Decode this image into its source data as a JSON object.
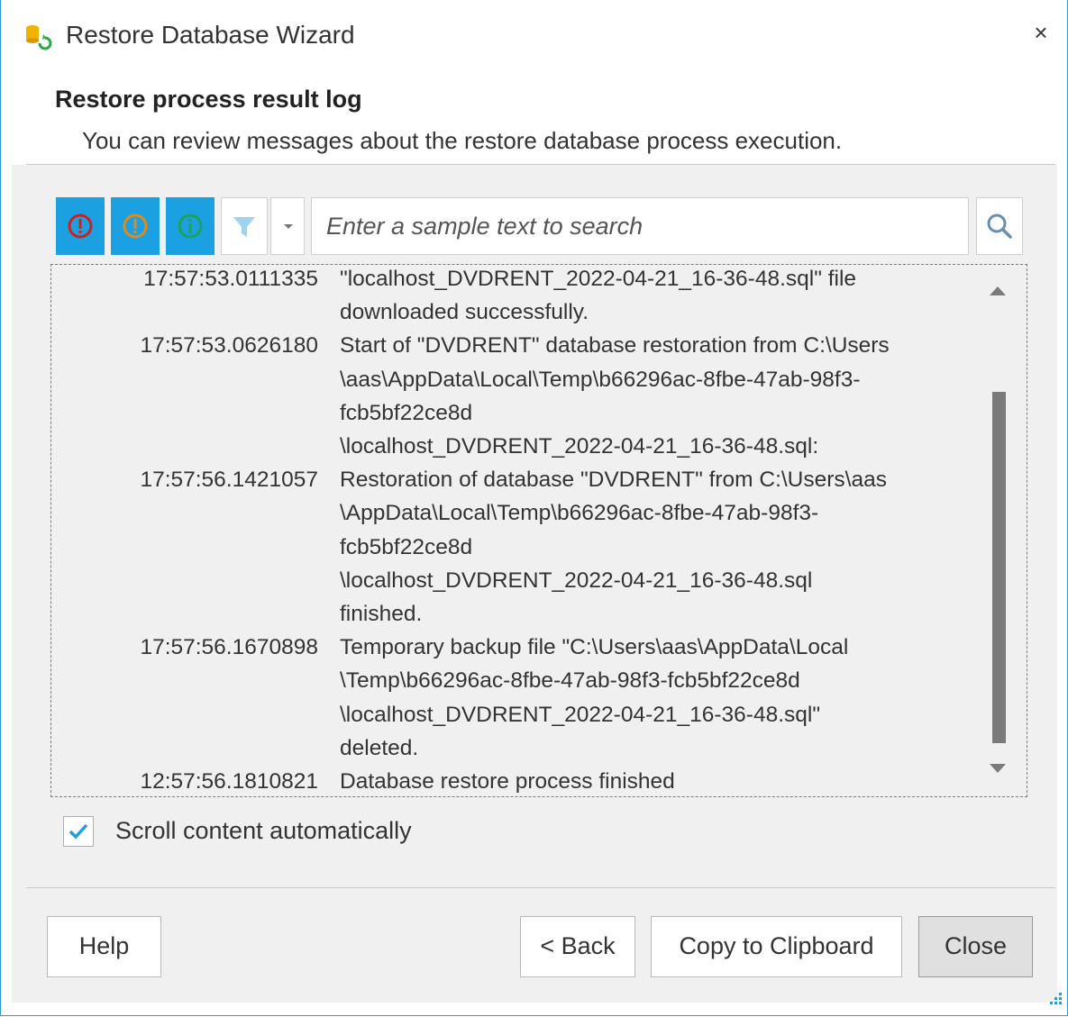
{
  "window": {
    "title": "Restore Database Wizard",
    "close_glyph": "×"
  },
  "header": {
    "title": "Restore process result log",
    "subtitle": "You can review messages about the restore database process execution."
  },
  "toolbar": {
    "errors_icon": "error-circle-icon",
    "warnings_icon": "warning-circle-icon",
    "info_icon": "info-circle-icon",
    "filter_icon": "funnel-icon",
    "accent_color": "#1ba1e2",
    "search_placeholder": "Enter a sample text to search"
  },
  "log": [
    {
      "time": "17:57:53.0111335",
      "lines": [
        "\"localhost_DVDRENT_2022-04-21_16-36-48.sql\" file",
        "downloaded successfully."
      ]
    },
    {
      "time": "17:57:53.0626180",
      "lines": [
        "Start of \"DVDRENT\" database restoration from C:\\Users",
        "\\aas\\AppData\\Local\\Temp\\b66296ac-8fbe-47ab-98f3-",
        "fcb5bf22ce8d",
        "\\localhost_DVDRENT_2022-04-21_16-36-48.sql:"
      ]
    },
    {
      "time": "17:57:56.1421057",
      "lines": [
        "Restoration of database \"DVDRENT\" from C:\\Users\\aas",
        "\\AppData\\Local\\Temp\\b66296ac-8fbe-47ab-98f3-",
        "fcb5bf22ce8d",
        "\\localhost_DVDRENT_2022-04-21_16-36-48.sql",
        "finished."
      ]
    },
    {
      "time": "17:57:56.1670898",
      "lines": [
        "Temporary backup file \"C:\\Users\\aas\\AppData\\Local",
        "\\Temp\\b66296ac-8fbe-47ab-98f3-fcb5bf22ce8d",
        "\\localhost_DVDRENT_2022-04-21_16-36-48.sql\"",
        "deleted."
      ]
    },
    {
      "time": "12:57:56.1810821",
      "lines": [
        "Database restore process finished"
      ]
    }
  ],
  "options": {
    "auto_scroll_label": "Scroll content automatically",
    "auto_scroll_checked": true
  },
  "buttons": {
    "help": "Help",
    "back": "< Back",
    "copy": "Copy to Clipboard",
    "close": "Close"
  }
}
